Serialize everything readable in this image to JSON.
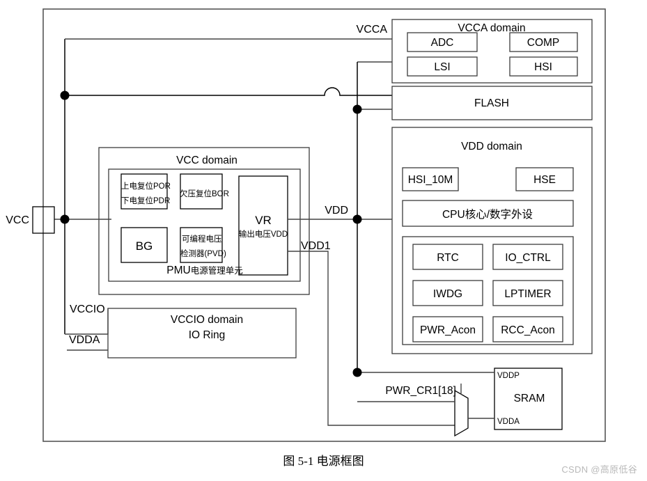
{
  "figure": {
    "caption": "图 5-1 电源框图",
    "watermark": "CSDN @高原低谷"
  },
  "pins": [
    {
      "name": "VCC",
      "label": "VCC"
    },
    {
      "name": "VCCIO",
      "label": "VCCIO"
    },
    {
      "name": "VDDA",
      "label": "VDDA"
    }
  ],
  "rails": {
    "vcca": "VCCA",
    "vdd": "VDD",
    "vdd1": "VDD1"
  },
  "vcca_domain": {
    "title": "VCCA domain",
    "blocks": [
      {
        "label": "ADC"
      },
      {
        "label": "COMP"
      },
      {
        "label": "LSI"
      },
      {
        "label": "HSI"
      }
    ]
  },
  "flash": {
    "label": "FLASH"
  },
  "vdd_domain": {
    "title": "VDD domain",
    "oscillators": [
      {
        "label": "HSI_10M"
      },
      {
        "label": "HSE"
      }
    ],
    "cpu": {
      "label": "CPU核心/数字外设"
    },
    "peripherals": [
      {
        "label": "RTC"
      },
      {
        "label": "IO_CTRL"
      },
      {
        "label": "IWDG"
      },
      {
        "label": "LPTIMER"
      },
      {
        "label": "PWR_Acon"
      },
      {
        "label": "RCC_Acon"
      }
    ]
  },
  "vcc_domain": {
    "title": "VCC domain",
    "pmu_label_prefix": "PMU",
    "pmu_label_suffix": "电源管理单元",
    "reset_block": {
      "line1": "上电复位POR",
      "line2": "下电复位PDR"
    },
    "bor_block": {
      "label": "欠压复位BOR"
    },
    "bg_block": {
      "label": "BG"
    },
    "pvd_block": {
      "line1": "可编程电压",
      "line2": "检测器(PVD)"
    },
    "vr_block": {
      "title": "VR",
      "subtitle": "输出电压VDD"
    }
  },
  "vccio_domain": {
    "line1": "VCCIO domain",
    "line2": "IO Ring"
  },
  "sram": {
    "label": "SRAM",
    "pin_top": "VDDP",
    "pin_bottom": "VDDA",
    "mux_control": "PWR_CR1[18]"
  },
  "colors": {
    "stroke": "#3c3c3c",
    "frame": "#555555",
    "text": "#000000",
    "watermark": "#b9b9b9"
  }
}
